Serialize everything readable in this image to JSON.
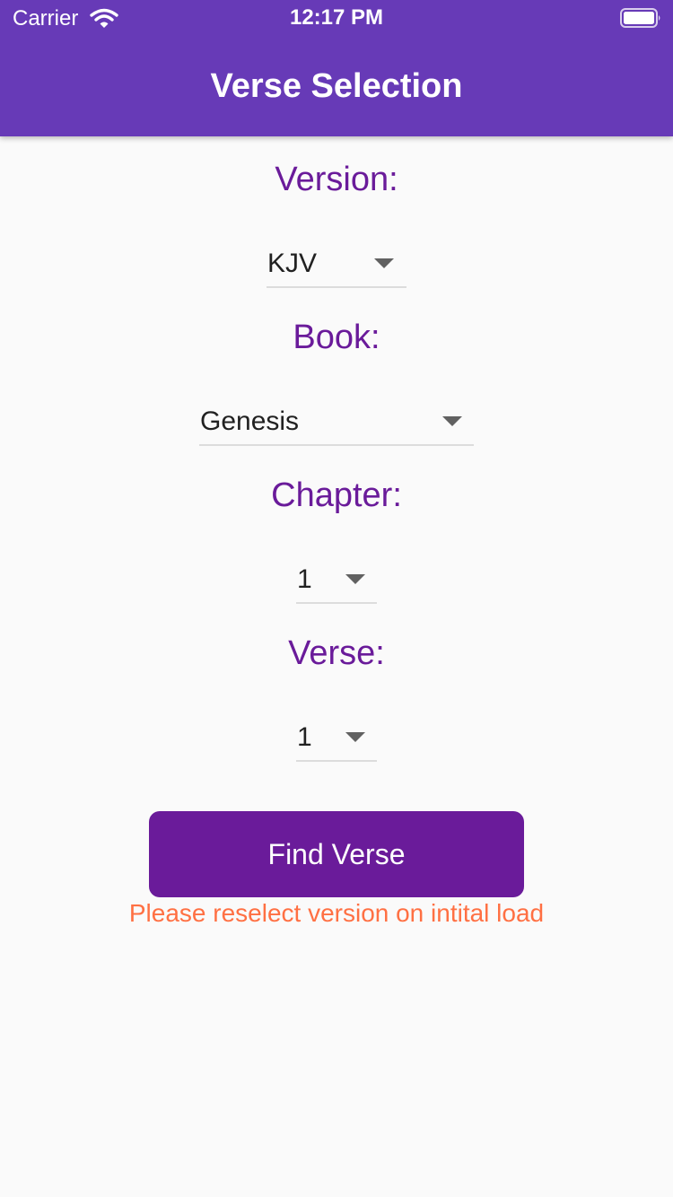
{
  "status_bar": {
    "carrier": "Carrier",
    "time": "12:17 PM"
  },
  "header": {
    "title": "Verse Selection",
    "background_color": "#673ab7"
  },
  "form": {
    "version": {
      "label": "Version:",
      "value": "KJV"
    },
    "book": {
      "label": "Book:",
      "value": "Genesis"
    },
    "chapter": {
      "label": "Chapter:",
      "value": "1"
    },
    "verse": {
      "label": "Verse:",
      "value": "1"
    }
  },
  "find_button": {
    "label": "Find Verse",
    "color": "#6a1b9a"
  },
  "hint": {
    "text": "Please reselect version on intital load",
    "color": "#ff7043"
  },
  "colors": {
    "label": "#6a1b9a",
    "background": "#fafafa"
  }
}
